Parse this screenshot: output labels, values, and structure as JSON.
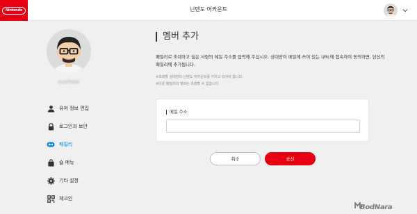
{
  "header": {
    "logo_text": "Nintendo",
    "title": "닌텐도 어카운트"
  },
  "sidebar": {
    "username": "xuxfoxx",
    "items": [
      {
        "label": "유저 정보 편집",
        "icon": "person-icon",
        "active": false
      },
      {
        "label": "로그인과 보안",
        "icon": "lock-icon",
        "active": false
      },
      {
        "label": "패밀리",
        "icon": "family-icon",
        "active": true
      },
      {
        "label": "숍 메뉴",
        "icon": "shopping-bag-icon",
        "active": false
      },
      {
        "label": "기타 설정",
        "icon": "gear-icon",
        "active": false
      },
      {
        "label": "체크인",
        "icon": "qr-code-icon",
        "active": false
      }
    ]
  },
  "main": {
    "title": "멤버 추가",
    "description": "패밀리로 초대하고 싶은 사람의 메일 주소를 입력해 주십시오. 상대방이 메일에 쓰여 있는 URL에 접속하여 동의하면, 당신의 패밀리에 추가됩니다.",
    "notes": [
      "※초대할 상대방이 닌텐도 어카운트를 가지고 있어야 합니다.",
      "※다른 패밀리의 멤버는 초대할 수 없습니다."
    ],
    "email_label": "메일 주소",
    "email_value": "",
    "cancel_label": "취소",
    "send_label": "송신"
  },
  "watermark": "BodNara",
  "colors": {
    "brand_red": "#e60012",
    "active_blue": "#0088e0",
    "page_bg": "#f0f0f0"
  }
}
